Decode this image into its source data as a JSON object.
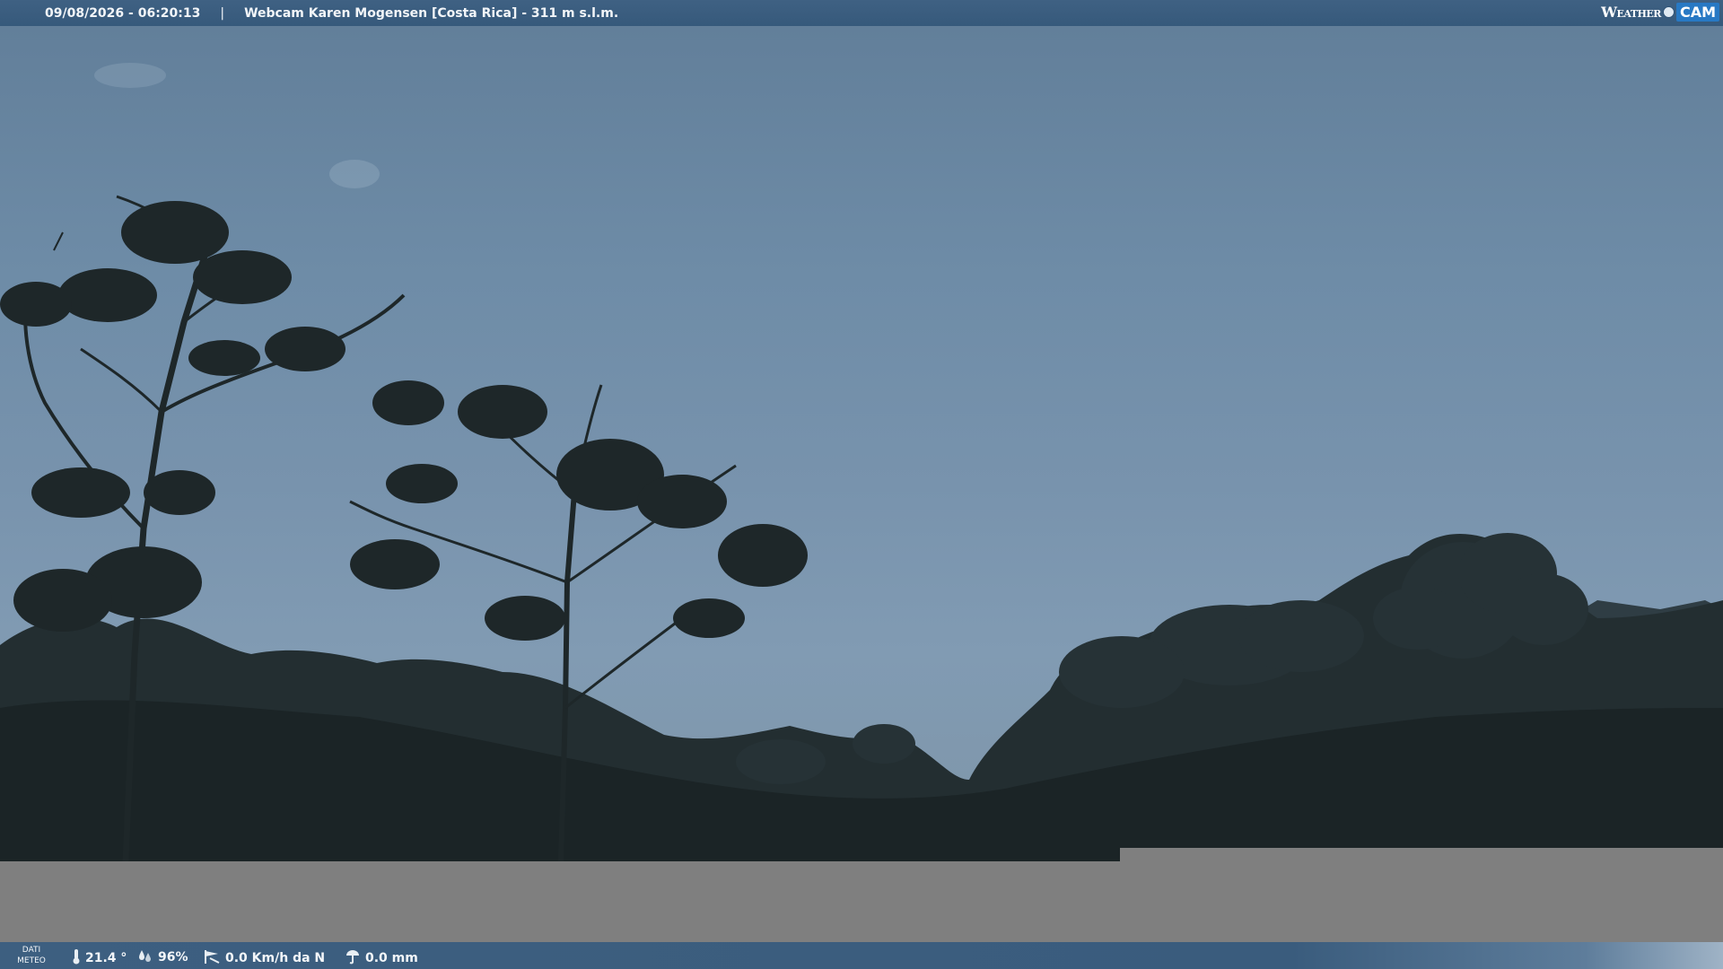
{
  "header": {
    "timestamp": "09/08/2026 - 06:20:13",
    "separator": "|",
    "camera_title": "Webcam Karen Mogensen [Costa Rica]  - 311 m s.l.m."
  },
  "brand": {
    "logo_text_weather": "Weather",
    "logo_text_cam": "CAM",
    "accent_color": "#2879c4"
  },
  "footer": {
    "data_label_line1": "DATI",
    "data_label_line2": "METEO",
    "temperature": "21.4 °",
    "humidity": "96%",
    "wind": "0.0 Km/h da N",
    "rain": "0.0 mm",
    "icons": [
      "thermometer-icon",
      "humidity-icon",
      "wind-icon",
      "rain-gauge-icon"
    ]
  },
  "colors": {
    "bar_blue": "#3d5f80",
    "sky": "#7893ad",
    "vegetation": "#1f2a2d",
    "grey_panel": "#7f7f7f"
  }
}
